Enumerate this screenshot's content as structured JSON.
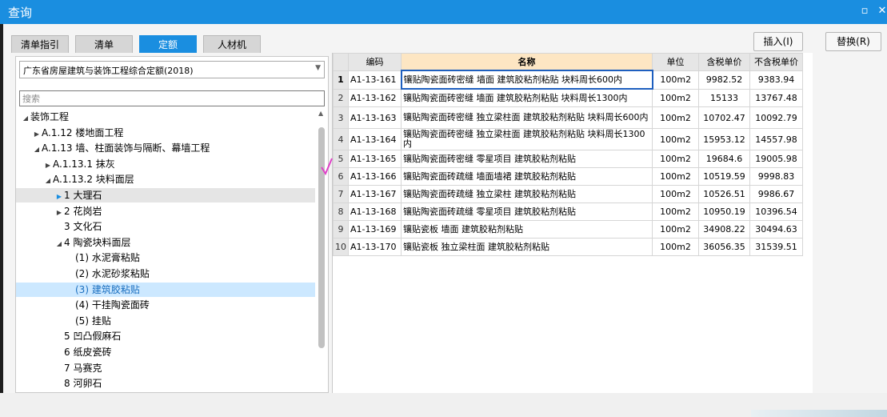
{
  "window": {
    "title": "查询",
    "min_icon": "minimize-icon",
    "close_icon": "close-icon"
  },
  "tabs": [
    {
      "label": "清单指引",
      "active": false
    },
    {
      "label": "清单",
      "active": false
    },
    {
      "label": "定额",
      "active": true
    },
    {
      "label": "人材机",
      "active": false
    }
  ],
  "actions": {
    "insert": "插入(I)",
    "replace": "替换(R)"
  },
  "library": {
    "selected": "广东省房屋建筑与装饰工程综合定额(2018)"
  },
  "search": {
    "placeholder": "搜索",
    "value": ""
  },
  "tree": [
    {
      "label": "装饰工程",
      "expander": "◢"
    },
    {
      "label": "A.1.12 楼地面工程",
      "expander": "▶"
    },
    {
      "label": "A.1.13 墙、柱面装饰与隔断、幕墙工程",
      "expander": "◢"
    },
    {
      "label": "A.1.13.1 抹灰",
      "expander": "▶"
    },
    {
      "label": "A.1.13.2 块料面层",
      "expander": "◢"
    },
    {
      "label": "1 大理石",
      "expander": "▶",
      "state": "hover"
    },
    {
      "label": "2 花岗岩",
      "expander": "▶"
    },
    {
      "label": "3 文化石",
      "expander": ""
    },
    {
      "label": "4 陶瓷块料面层",
      "expander": "◢"
    },
    {
      "label": "(1) 水泥膏粘贴",
      "expander": ""
    },
    {
      "label": "(2) 水泥砂浆粘贴",
      "expander": ""
    },
    {
      "label": "(3) 建筑胶粘贴",
      "expander": "",
      "state": "selected"
    },
    {
      "label": "(4) 干挂陶瓷面砖",
      "expander": ""
    },
    {
      "label": "(5) 挂贴",
      "expander": ""
    },
    {
      "label": "5 凹凸假麻石",
      "expander": ""
    },
    {
      "label": "6 纸皮瓷砖",
      "expander": ""
    },
    {
      "label": "7 马赛克",
      "expander": ""
    },
    {
      "label": "8 河卵石",
      "expander": ""
    }
  ],
  "table": {
    "headers": [
      "编码",
      "名称",
      "单位",
      "含税单价",
      "不含税单价"
    ],
    "rows": [
      {
        "no": "1",
        "code": "A1-13-161",
        "name": "镶贴陶瓷面砖密缝 墙面 建筑胶粘剂粘贴 块料周长600内",
        "unit": "100m2",
        "price_tax": "9982.52",
        "price_notax": "9383.94"
      },
      {
        "no": "2",
        "code": "A1-13-162",
        "name": "镶贴陶瓷面砖密缝 墙面 建筑胶粘剂粘贴 块料周长1300内",
        "unit": "100m2",
        "price_tax": "15133",
        "price_notax": "13767.48"
      },
      {
        "no": "3",
        "code": "A1-13-163",
        "name": "镶贴陶瓷面砖密缝 独立梁柱面 建筑胶粘剂粘贴 块料周长600内",
        "unit": "100m2",
        "price_tax": "10702.47",
        "price_notax": "10092.79"
      },
      {
        "no": "4",
        "code": "A1-13-164",
        "name": "镶贴陶瓷面砖密缝 独立梁柱面 建筑胶粘剂粘贴 块料周长1300内",
        "unit": "100m2",
        "price_tax": "15953.12",
        "price_notax": "14557.98"
      },
      {
        "no": "5",
        "code": "A1-13-165",
        "name": "镶贴陶瓷面砖密缝 零星项目 建筑胶粘剂粘贴",
        "unit": "100m2",
        "price_tax": "19684.6",
        "price_notax": "19005.98"
      },
      {
        "no": "6",
        "code": "A1-13-166",
        "name": "镶贴陶瓷面砖疏缝 墙面墙裙 建筑胶粘剂粘贴",
        "unit": "100m2",
        "price_tax": "10519.59",
        "price_notax": "9998.83"
      },
      {
        "no": "7",
        "code": "A1-13-167",
        "name": "镶贴陶瓷面砖疏缝 独立梁柱 建筑胶粘剂粘贴",
        "unit": "100m2",
        "price_tax": "10526.51",
        "price_notax": "9986.67"
      },
      {
        "no": "8",
        "code": "A1-13-168",
        "name": "镶贴陶瓷面砖疏缝 零星项目 建筑胶粘剂粘贴",
        "unit": "100m2",
        "price_tax": "10950.19",
        "price_notax": "10396.54"
      },
      {
        "no": "9",
        "code": "A1-13-169",
        "name": "镶贴瓷板 墙面 建筑胶粘剂粘贴",
        "unit": "100m2",
        "price_tax": "34908.22",
        "price_notax": "30494.63"
      },
      {
        "no": "10",
        "code": "A1-13-170",
        "name": "镶贴瓷板 独立梁柱面 建筑胶粘剂粘贴",
        "unit": "100m2",
        "price_tax": "36056.35",
        "price_notax": "31539.51"
      }
    ]
  },
  "colors": {
    "accent": "#1a8ee0",
    "header_highlight": "#fde6c3",
    "selection": "#cce8ff",
    "annotation": "#e040c8"
  }
}
